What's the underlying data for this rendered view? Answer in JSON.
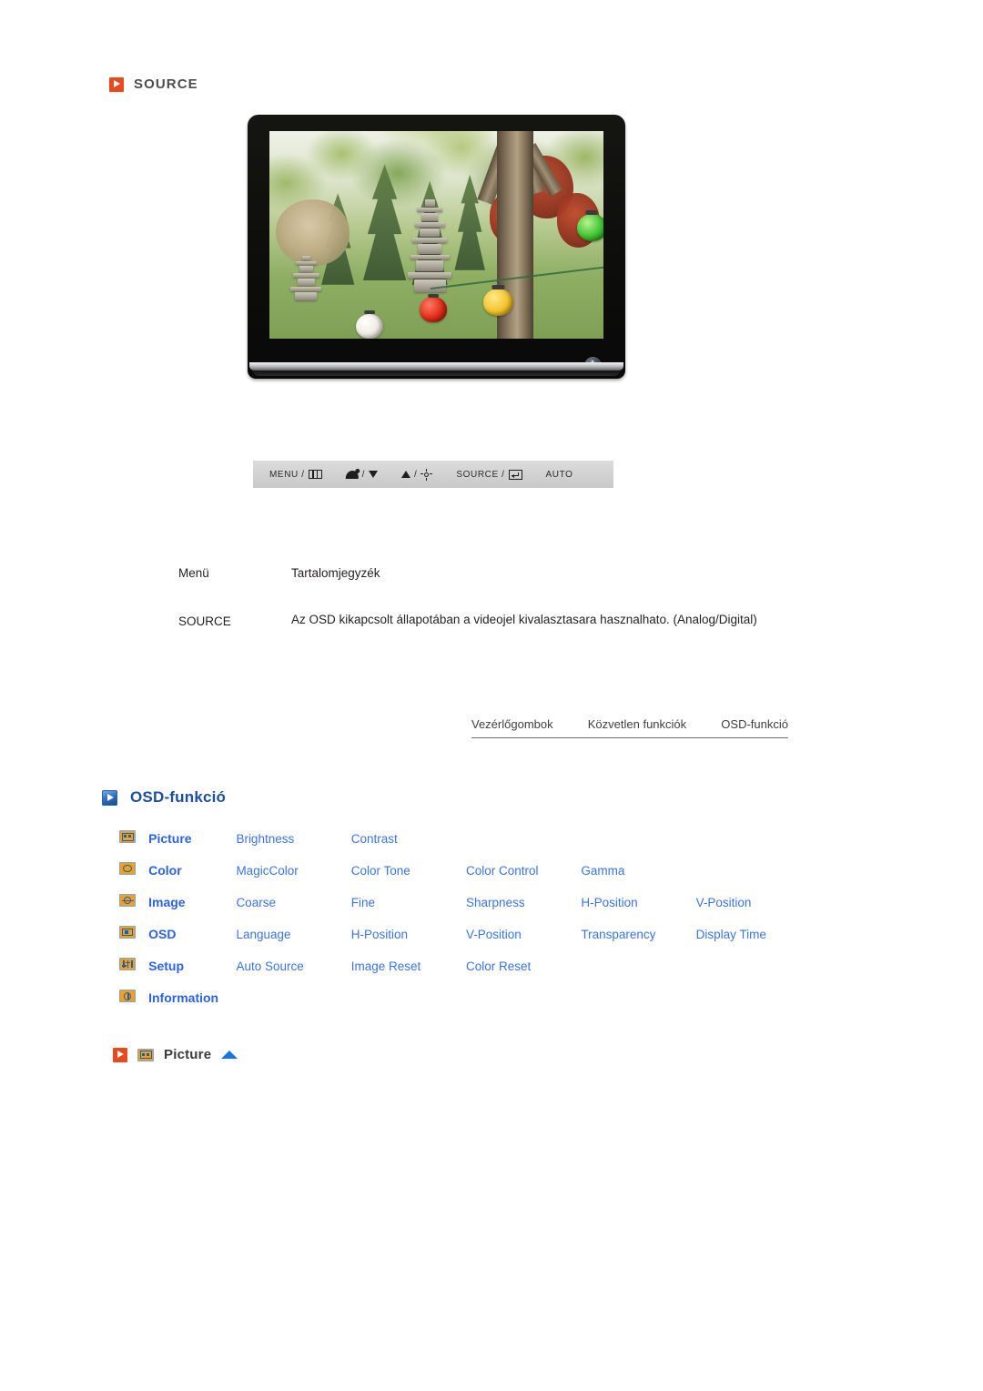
{
  "sections": {
    "source": {
      "heading": "SOURCE",
      "icon": "orange-play-icon"
    },
    "osd_function": {
      "heading": "OSD-funkció",
      "icon": "blue-play-icon"
    }
  },
  "monitor": {
    "alt": "Samsung LCD monitor elölnézet, kerti tájkép a képernyőn",
    "power_button": "power-button"
  },
  "control_strip": {
    "buttons": [
      {
        "label": "MENU /",
        "icon": "menu-bars-icon"
      },
      {
        "label": "/",
        "icon_left": "magicbright-icon",
        "icon_right": "triangle-down-icon"
      },
      {
        "label": "/",
        "icon_left": "triangle-up-icon",
        "icon_right": "brightness-sun-icon"
      },
      {
        "label": "SOURCE /",
        "icon": "enter-key-icon"
      },
      {
        "label": "AUTO",
        "icon": ""
      }
    ]
  },
  "desc_table": {
    "headers": {
      "menu": "Menü",
      "contents": "Tartalomjegyzék"
    },
    "rows": [
      {
        "menu": "SOURCE",
        "contents": "Az OSD kikapcsolt állapotában a videojel kivalasztasara hasznalhato. (Analog/Digital)"
      }
    ]
  },
  "tabbar": {
    "tabs": [
      {
        "label": "Vezérlőgombok"
      },
      {
        "label": "Közvetlen funkciók"
      },
      {
        "label": "OSD-funkció"
      }
    ]
  },
  "osd_grid": {
    "rows": [
      {
        "icon": "picture-icon",
        "category": "Picture",
        "items": [
          "Brightness",
          "Contrast"
        ]
      },
      {
        "icon": "color-icon",
        "category": "Color",
        "items": [
          "MagicColor",
          "Color Tone",
          "Color Control",
          "Gamma"
        ]
      },
      {
        "icon": "image-icon",
        "category": "Image",
        "items": [
          "Coarse",
          "Fine",
          "Sharpness",
          "H-Position",
          "V-Position"
        ]
      },
      {
        "icon": "osd-icon",
        "category": "OSD",
        "items": [
          "Language",
          "H-Position",
          "V-Position",
          "Transparency",
          "Display Time"
        ]
      },
      {
        "icon": "setup-icon",
        "category": "Setup",
        "items": [
          "Auto Source",
          "Image Reset",
          "Color Reset"
        ]
      },
      {
        "icon": "information-icon",
        "category": "Information",
        "items": []
      }
    ]
  },
  "anchor_row": {
    "play_icon": "orange-play-icon",
    "menu_icon": "picture-icon",
    "label": "Picture",
    "top_arrow": "back-to-top-arrow"
  },
  "colors": {
    "orange_accent": "#e8491d",
    "link_blue": "#3a74ec",
    "heading_blue": "#1d4fa0",
    "icon_orange": "#f0a020",
    "text_gray": "#4d4d4d"
  }
}
